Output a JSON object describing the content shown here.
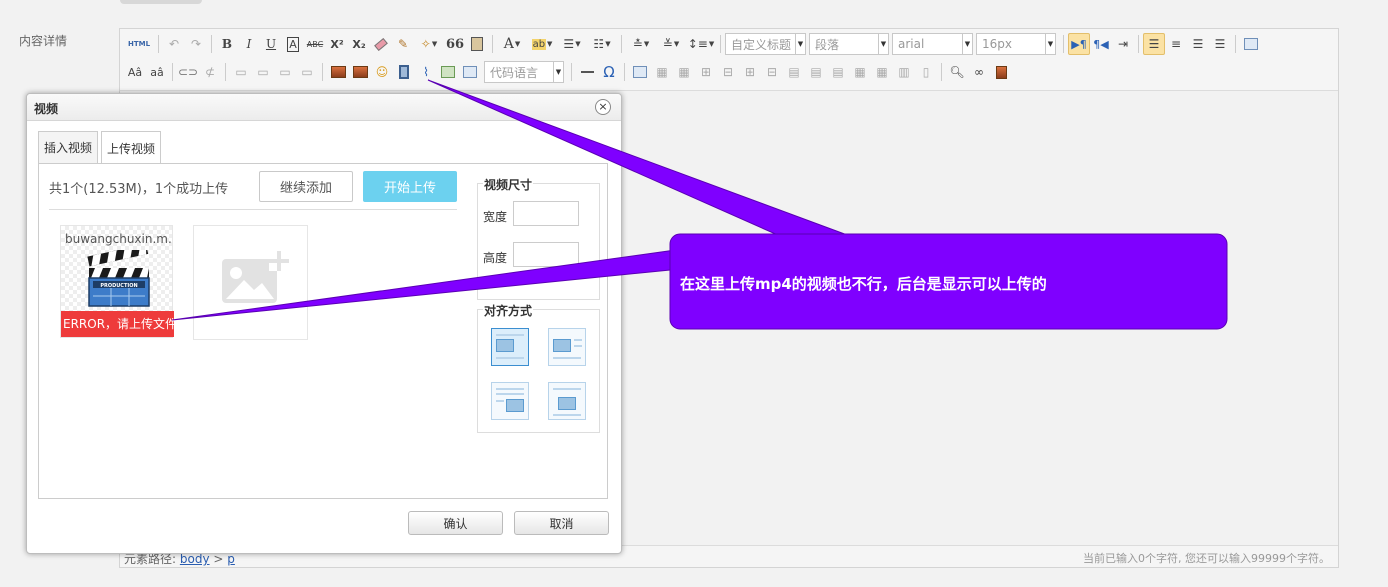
{
  "page": {
    "field_label": "内容详情"
  },
  "toolbar": {
    "html_label": "HTML",
    "bold": "B",
    "italic": "I",
    "underline": "U",
    "fontborder": "A",
    "strike": "ABC",
    "superscript": "X²",
    "subscript": "X₂",
    "blockquote": "66",
    "forecolor": "A",
    "backcolor": "ab",
    "custom_heading": "自定义标题",
    "paragraph": "段落",
    "font_family": "arial",
    "font_size": "16px",
    "code_language": "代码语言",
    "omega": "Ω"
  },
  "status": {
    "path_label": "元素路径:",
    "path_body": "body",
    "path_sep": ">",
    "path_p": "p",
    "counter": "当前已输入0个字符, 您还可以输入99999个字符。"
  },
  "dialog": {
    "title": "视频",
    "close_label": "×",
    "tabs": [
      {
        "label": "插入视频"
      },
      {
        "label": "上传视频"
      }
    ],
    "upload_info": "共1个(12.53M)，1个成功上传",
    "btn_continue": "继续添加",
    "btn_start": "开始上传",
    "file_name": "buwangchuxin.m...",
    "clap_text": "PRODUCTION",
    "file_error": "ERROR，请上传文件",
    "size_legend": "视频尺寸",
    "width_label": "宽度",
    "height_label": "高度",
    "width_value": "",
    "height_value": "",
    "align_legend": "对齐方式",
    "ok_label": "确认",
    "cancel_label": "取消"
  },
  "callout": {
    "text": "在这里上传mp4的视频也不行，后台是显示可以上传的",
    "color": "#7f00ff"
  }
}
